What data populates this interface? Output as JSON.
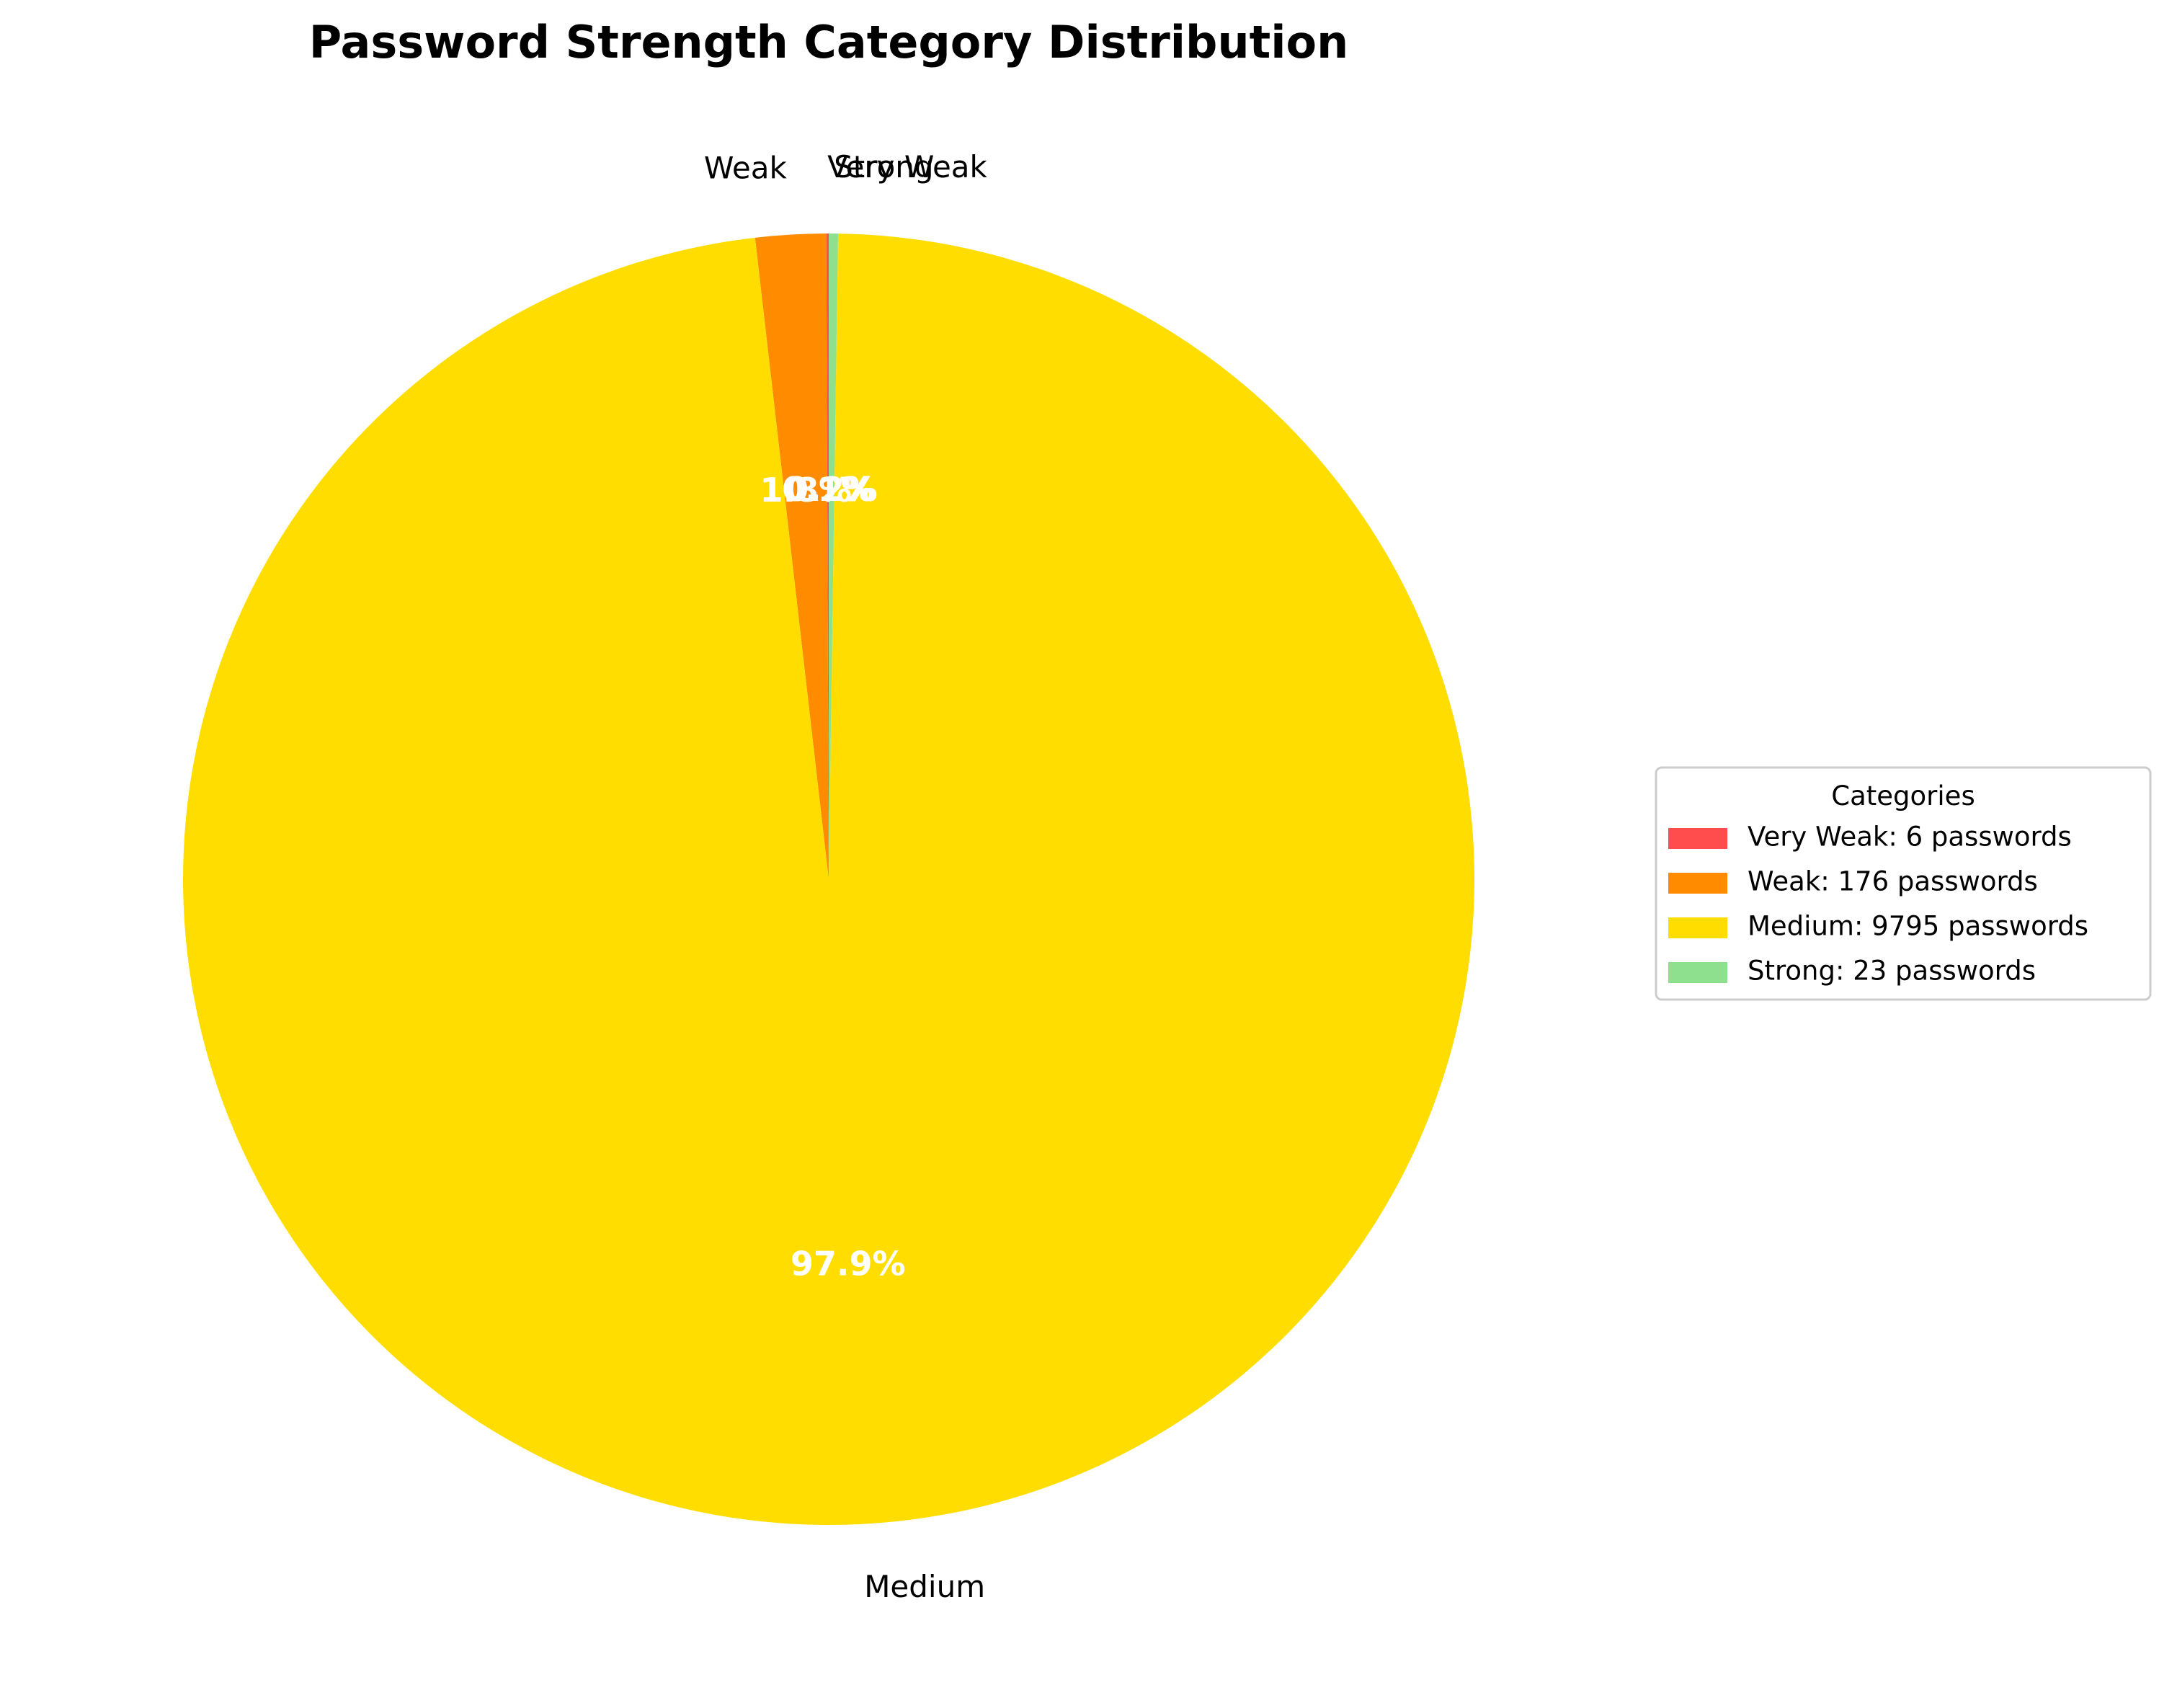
{
  "chart_data": {
    "type": "pie",
    "title": "Password Strength Category Distribution",
    "categories": [
      "Very Weak",
      "Weak",
      "Medium",
      "Strong"
    ],
    "values": [
      6,
      176,
      9795,
      23
    ],
    "percent_labels": [
      "0.1%",
      "1.8%",
      "97.9%",
      "0.2%"
    ],
    "colors": [
      "#ff4d4d",
      "#ff8c00",
      "#ffdd00",
      "#8ee08e"
    ],
    "start_angle_deg": 90,
    "direction": "counterclockwise",
    "legend": {
      "title": "Categories",
      "placement": "center-right",
      "entries": [
        "Very Weak: 6 passwords",
        "Weak: 176 passwords",
        "Medium: 9795 passwords",
        "Strong: 23 passwords"
      ]
    }
  }
}
